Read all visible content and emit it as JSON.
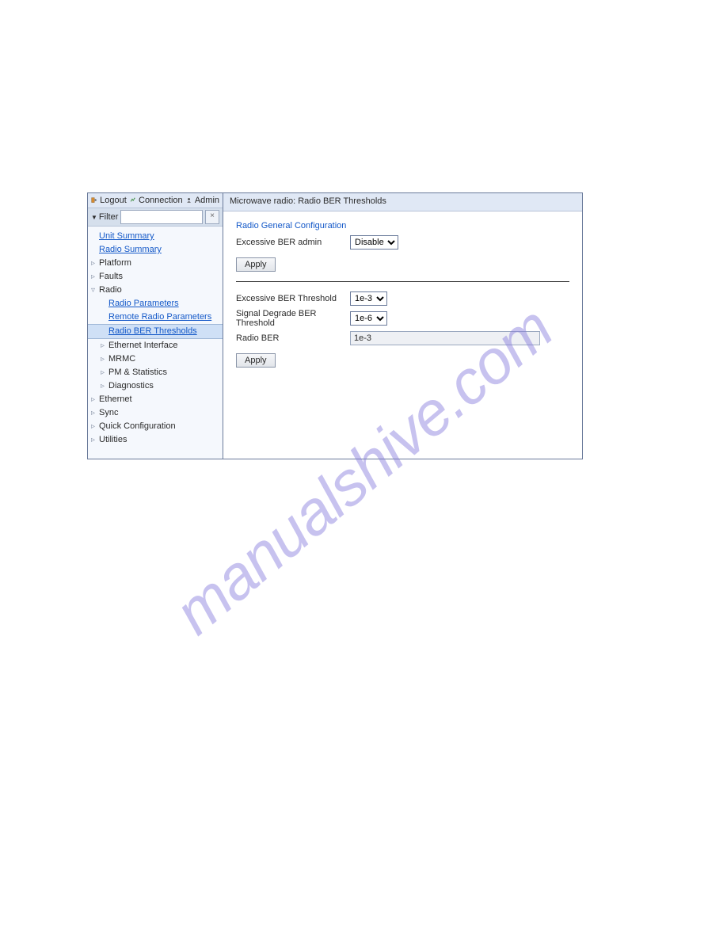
{
  "watermark": "manualshive.com",
  "sidebar": {
    "top": {
      "logout": "Logout",
      "connection": "Connection",
      "admin": "Admin"
    },
    "filter": {
      "label": "Filter",
      "value": "",
      "clear": "×"
    },
    "nav": {
      "unit_summary": "Unit Summary",
      "radio_summary": "Radio Summary",
      "platform": "Platform",
      "faults": "Faults",
      "radio": "Radio",
      "radio_children": {
        "radio_parameters": "Radio Parameters",
        "remote_radio_parameters": "Remote Radio Parameters",
        "radio_ber_thresholds": "Radio BER Thresholds",
        "ethernet_interface": "Ethernet Interface",
        "mrmc": "MRMC",
        "pm_statistics": "PM & Statistics",
        "diagnostics": "Diagnostics"
      },
      "ethernet": "Ethernet",
      "sync": "Sync",
      "quick_configuration": "Quick Configuration",
      "utilities": "Utilities"
    }
  },
  "main": {
    "header": "Microwave radio: Radio BER Thresholds",
    "section_title": "Radio General Configuration",
    "excessive_ber_admin_label": "Excessive BER admin",
    "excessive_ber_admin_value": "Disable",
    "apply1": "Apply",
    "excessive_ber_threshold_label": "Excessive BER Threshold",
    "excessive_ber_threshold_value": "1e-3",
    "signal_degrade_label": "Signal Degrade BER Threshold",
    "signal_degrade_value": "1e-6",
    "radio_ber_label": "Radio BER",
    "radio_ber_value": "1e-3",
    "apply2": "Apply"
  }
}
